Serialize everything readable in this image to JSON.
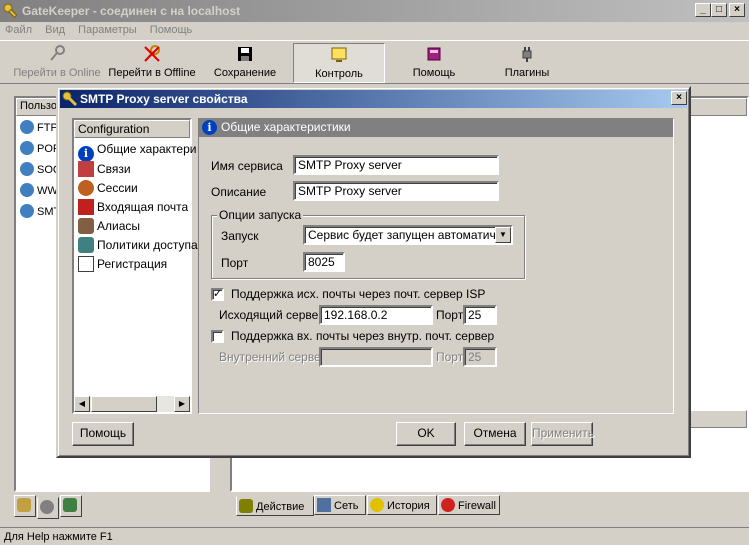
{
  "window": {
    "title": "GateKeeper - соединен с на localhost"
  },
  "menu": [
    "Файл",
    "Вид",
    "Параметры",
    "Помощь"
  ],
  "toolbar": {
    "go_online": "Перейти в Online",
    "go_offline": "Перейти в Offline",
    "save": "Сохранение",
    "control": "Контроль",
    "help": "Помощь",
    "plugins": "Плагины"
  },
  "left_panel": {
    "header": "Пользо",
    "items": [
      "FTP",
      "POP",
      "SOC",
      "WW",
      "SMT"
    ]
  },
  "bottom_tabs": [
    "Действие",
    "Сеть",
    "История",
    "Firewall"
  ],
  "status": "Для Help нажмите F1",
  "dialog": {
    "title": "SMTP Proxy server свойства",
    "nav_header": "Configuration",
    "nav": [
      "Общие характери",
      "Связи",
      "Сессии",
      "Входящая почта",
      "Алиасы",
      "Политики доступа",
      "Регистрация"
    ],
    "section_title": "Общие характеристики",
    "service_name_label": "Имя сервиса",
    "service_name": "SMTP Proxy server",
    "description_label": "Описание",
    "description": "SMTP Proxy server",
    "startup_group": "Опции запуска",
    "startup_label": "Запуск",
    "startup_value": "Сервис будет запущен автоматическ",
    "port_label": "Порт",
    "port_value": "8025",
    "isp_checkbox": "Поддержка исх. почты через почт. сервер ISP",
    "isp_checked": true,
    "outgoing_label": "Исходящий сервер",
    "outgoing_value": "192.168.0.2",
    "outgoing_port_label": "Порт",
    "outgoing_port": "25",
    "internal_checkbox": "Поддержка вх. почты через внутр. почт. сервер",
    "internal_checked": false,
    "internal_label": "Внутренний сервер",
    "internal_value": "",
    "internal_port_label": "Порт",
    "internal_port": "25",
    "help_btn": "Помощь",
    "ok_btn": "OK",
    "cancel_btn": "Отмена",
    "apply_btn": "Применить"
  }
}
